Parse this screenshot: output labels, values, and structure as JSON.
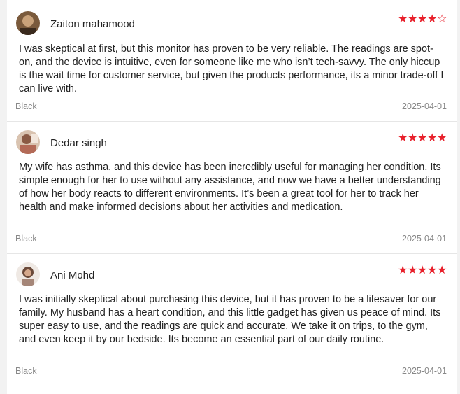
{
  "reviews": [
    {
      "author": "Zaiton mahamood",
      "rating": 4,
      "max_rating": 5,
      "text": "I was skeptical at first, but this monitor has proven to be very reliable. The readings are spot-on, and the device is intuitive, even for someone like me who isn’t tech-savvy. The only hiccup is the wait time for customer service, but given the products performance, its a minor trade-off I can live with.",
      "variant": "Black",
      "date": "2025-04-01"
    },
    {
      "author": "Dedar singh",
      "rating": 5,
      "max_rating": 5,
      "text": "My wife has asthma, and this device has been incredibly useful for managing her condition. Its simple enough for her to use without any assistance, and now we have a better understanding of how her body reacts to different environments. It’s been a great tool for her to track her health and make informed decisions about her activities and medication.",
      "variant": "Black",
      "date": "2025-04-01"
    },
    {
      "author": "Ani Mohd",
      "rating": 5,
      "max_rating": 5,
      "text": "I was initially skeptical about purchasing this device, but it has proven to be a lifesaver for our family. My husband has a heart condition, and this little gadget has given us peace of mind. Its super easy to use, and the readings are quick and accurate. We take it on trips, to the gym, and even keep it by our bedside. Its become an essential part of our daily routine.",
      "variant": "Black",
      "date": "2025-04-01"
    }
  ],
  "colors": {
    "star": "#e8202b",
    "meta_text": "#888888",
    "divider": "#e6e6e6"
  }
}
